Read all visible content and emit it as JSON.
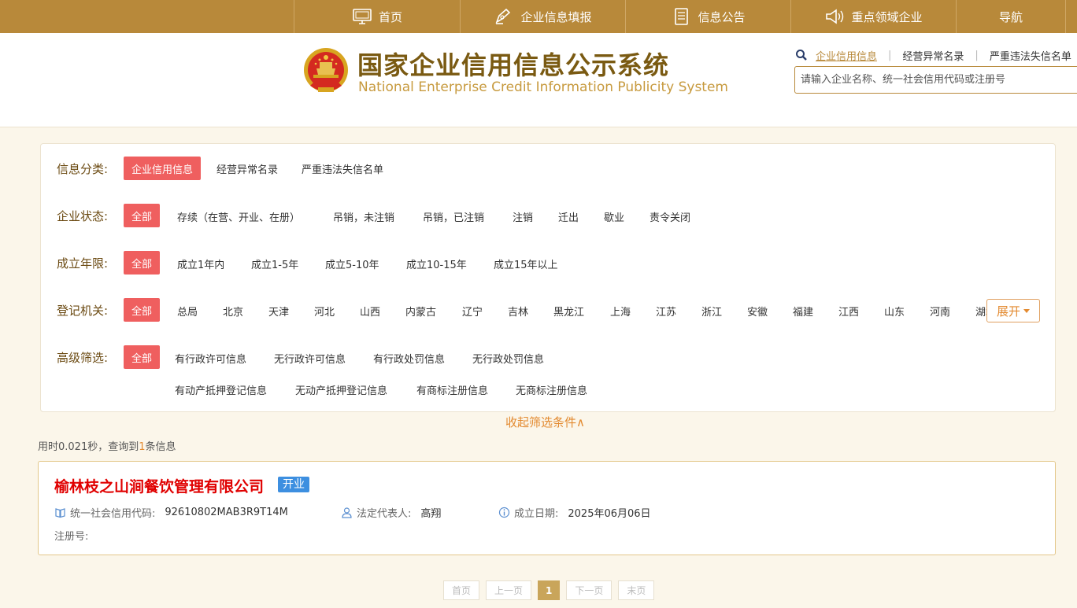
{
  "nav": {
    "items": [
      {
        "label": "首页",
        "icon": "monitor-icon"
      },
      {
        "label": "企业信息填报",
        "icon": "edit-icon"
      },
      {
        "label": "信息公告",
        "icon": "document-icon"
      },
      {
        "label": "重点领域企业",
        "icon": "speaker-icon"
      },
      {
        "label": "导航",
        "icon": ""
      }
    ]
  },
  "header": {
    "title_cn": "国家企业信用信息公示系统",
    "title_en": "National Enterprise Credit Information Publicity System",
    "search_tabs": [
      "企业信用信息",
      "经营异常名录",
      "严重违法失信名单"
    ],
    "search_placeholder": "请输入企业名称、统一社会信用代码或注册号"
  },
  "filters": {
    "category": {
      "label": "信息分类:",
      "options": [
        "企业信用信息",
        "经营异常名录",
        "严重违法失信名单"
      ]
    },
    "status": {
      "label": "企业状态:",
      "options": [
        "全部",
        "存续（在营、开业、在册）",
        "吊销，未注销",
        "吊销，已注销",
        "注销",
        "迁出",
        "歇业",
        "责令关闭"
      ]
    },
    "age": {
      "label": "成立年限:",
      "options": [
        "全部",
        "成立1年内",
        "成立1-5年",
        "成立5-10年",
        "成立10-15年",
        "成立15年以上"
      ]
    },
    "authority": {
      "label": "登记机关:",
      "options": [
        "全部",
        "总局",
        "北京",
        "天津",
        "河北",
        "山西",
        "内蒙古",
        "辽宁",
        "吉林",
        "黑龙江",
        "上海",
        "江苏",
        "浙江",
        "安徽",
        "福建",
        "江西",
        "山东",
        "河南",
        "湖北"
      ]
    },
    "advanced": {
      "label": "高级筛选:",
      "row1": [
        "全部",
        "有行政许可信息",
        "无行政许可信息",
        "有行政处罚信息",
        "无行政处罚信息"
      ],
      "row2": [
        "有动产抵押登记信息",
        "无动产抵押登记信息",
        "有商标注册信息",
        "无商标注册信息"
      ]
    },
    "expand_label": "展开",
    "collapse_label": "收起筛选条件∧"
  },
  "stats": {
    "prefix": "用时0.021秒，查询到",
    "count": "1",
    "suffix": "条信息"
  },
  "result": {
    "name": "榆林枝之山涧餐饮管理有限公司",
    "status": "开业",
    "credit_code_label": "统一社会信用代码:",
    "credit_code": "92610802MAB3R9T14M",
    "rep_label": "法定代表人:",
    "rep": "高翔",
    "date_label": "成立日期:",
    "date": "2025年06月06日",
    "reg_label": "注册号:"
  },
  "pagination": {
    "first": "首页",
    "prev": "上一页",
    "current": "1",
    "next": "下一页",
    "last": "末页"
  },
  "colors": {
    "brand": "#b8893a",
    "active_filter": "#ef5f5f",
    "company_name": "#e00000",
    "status_badge": "#3d8fe0"
  }
}
